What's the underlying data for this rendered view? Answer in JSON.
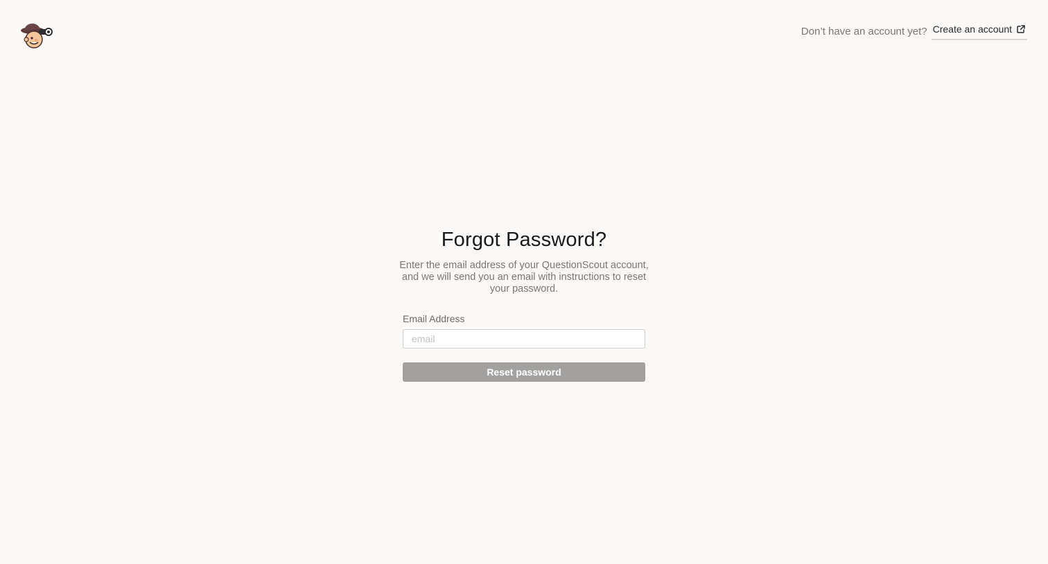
{
  "header": {
    "logo_icon": "detective-mascot-icon",
    "prompt": "Don’t have an account yet?",
    "create_account_label": "Create an account",
    "create_account_icon": "external-link-icon"
  },
  "main": {
    "title": "Forgot Password?",
    "description": "Enter the email address of your QuestionScout account, and we will send you an email with instructions to reset your password.",
    "email_label": "Email Address",
    "email_placeholder": "email",
    "email_value": "",
    "reset_button_label": "Reset password"
  },
  "colors": {
    "background": "#faf9f8",
    "button_disabled": "#a3a19f",
    "text_muted": "#7a7672"
  }
}
